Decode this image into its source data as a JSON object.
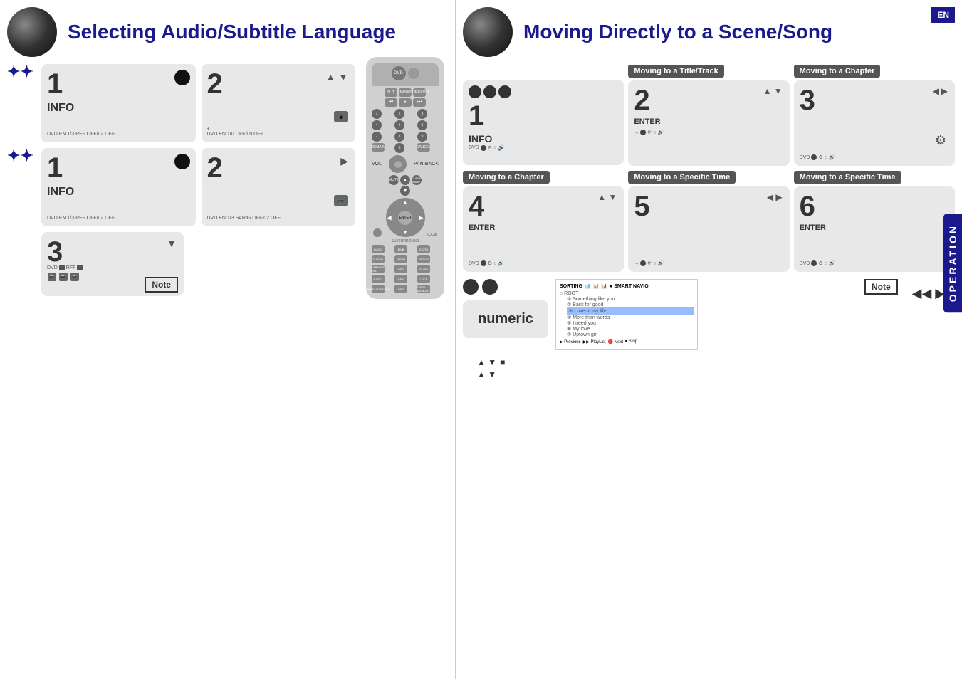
{
  "left": {
    "title": "Selecting Audio/Subtitle Language",
    "steps_row1": [
      {
        "number": "1",
        "label": "INFO",
        "has_star": true,
        "bottom_label": "DVD EN 1/3 RFF  OFF/02  OFF"
      },
      {
        "number": "2",
        "arrows": "▲ ▼",
        "bottom_label": "DVD EN 1/0  OFF/00  OFF"
      }
    ],
    "steps_row2": [
      {
        "number": "1",
        "label": "INFO",
        "has_star": true,
        "bottom_label": "DVD EN 1/3 RFF  OFF/02  OFF"
      },
      {
        "number": "2",
        "arrows": "▶",
        "bottom_label": "DVD EN 1/3 SARIG  OFF/02  OFF"
      }
    ],
    "step3": {
      "number": "3",
      "arrows": "▼",
      "bottom_label": "DVD"
    },
    "note_label": "Note"
  },
  "right": {
    "title": "Moving Directly to a Scene/Song",
    "en_badge": "EN",
    "sections": {
      "title_track_label": "Moving to a Title/Track",
      "chapter_label": "Moving to a Chapter",
      "specific_time_label": "Moving to a Specific Time",
      "specific_time_label2": "Moving to a Specific Time"
    },
    "steps": [
      {
        "number": "1",
        "label": "INFO",
        "has_dots": true
      },
      {
        "number": "2",
        "arrows_updown": "▲ ▼",
        "label": "ENTER"
      },
      {
        "number": "3",
        "arrows_leftright": "◀ ▶",
        "gear": "⚙"
      },
      {
        "number": "4",
        "arrows_updown": "▲ ▼",
        "label": "ENTER"
      },
      {
        "number": "5",
        "arrows_leftright": "◀ ▶"
      },
      {
        "number": "6",
        "label": "ENTER"
      }
    ],
    "bottom": {
      "numeric_label": "numeric",
      "note_label": "Note",
      "nav_arrows1": "▲ ▼",
      "nav_arrows2": "▲ ▼",
      "small_square": "■",
      "skip_arrows": "◀◀  ▶▶"
    }
  },
  "operation_tab": "OPERATION"
}
